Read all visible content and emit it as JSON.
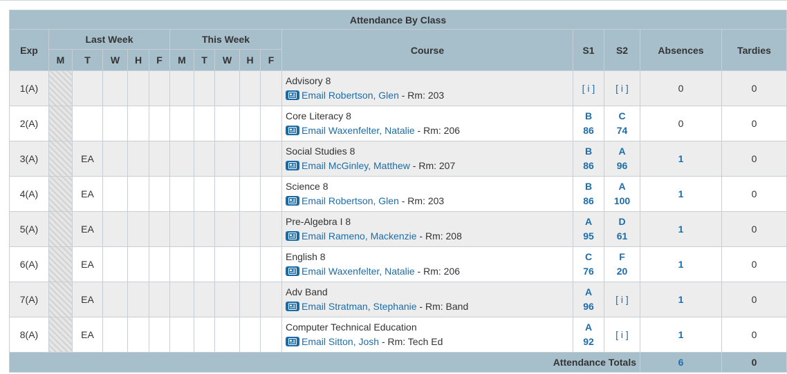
{
  "title": "Attendance By Class",
  "headers": {
    "exp": "Exp",
    "last_week": "Last Week",
    "this_week": "This Week",
    "course": "Course",
    "s1": "S1",
    "s2": "S2",
    "absences": "Absences",
    "tardies": "Tardies",
    "days": [
      "M",
      "T",
      "W",
      "H",
      "F",
      "M",
      "T",
      "W",
      "H",
      "F"
    ]
  },
  "email_label": "Email",
  "rows": [
    {
      "exp": "1(A)",
      "days": [
        "",
        "",
        "",
        "",
        "",
        "",
        "",
        "",
        "",
        ""
      ],
      "course": "Advisory 8",
      "teacher": "Robertson, Glen",
      "room": " - Rm: 203",
      "s1_grade": "[ i ]",
      "s1_pct": "",
      "s2_grade": "[ i ]",
      "s2_pct": "",
      "absences": "0",
      "tardies": "0"
    },
    {
      "exp": "2(A)",
      "days": [
        "",
        "",
        "",
        "",
        "",
        "",
        "",
        "",
        "",
        ""
      ],
      "course": "Core Literacy 8",
      "teacher": "Waxenfelter, Natalie",
      "room": " - Rm: 206",
      "s1_grade": "B",
      "s1_pct": "86",
      "s2_grade": "C",
      "s2_pct": "74",
      "absences": "0",
      "tardies": "0"
    },
    {
      "exp": "3(A)",
      "days": [
        "",
        "EA",
        "",
        "",
        "",
        "",
        "",
        "",
        "",
        ""
      ],
      "course": "Social Studies 8",
      "teacher": "McGinley, Matthew",
      "room": " - Rm: 207",
      "s1_grade": "B",
      "s1_pct": "86",
      "s2_grade": "A",
      "s2_pct": "96",
      "absences": "1",
      "tardies": "0"
    },
    {
      "exp": "4(A)",
      "days": [
        "",
        "EA",
        "",
        "",
        "",
        "",
        "",
        "",
        "",
        ""
      ],
      "course": "Science 8",
      "teacher": "Robertson, Glen",
      "room": " - Rm: 203",
      "s1_grade": "B",
      "s1_pct": "86",
      "s2_grade": "A",
      "s2_pct": "100",
      "absences": "1",
      "tardies": "0"
    },
    {
      "exp": "5(A)",
      "days": [
        "",
        "EA",
        "",
        "",
        "",
        "",
        "",
        "",
        "",
        ""
      ],
      "course": "Pre-Algebra I 8",
      "teacher": "Rameno, Mackenzie",
      "room": " - Rm: 208",
      "s1_grade": "A",
      "s1_pct": "95",
      "s2_grade": "D",
      "s2_pct": "61",
      "absences": "1",
      "tardies": "0"
    },
    {
      "exp": "6(A)",
      "days": [
        "",
        "EA",
        "",
        "",
        "",
        "",
        "",
        "",
        "",
        ""
      ],
      "course": "English 8",
      "teacher": "Waxenfelter, Natalie",
      "room": " - Rm: 206",
      "s1_grade": "C",
      "s1_pct": "76",
      "s2_grade": "F",
      "s2_pct": "20",
      "absences": "1",
      "tardies": "0"
    },
    {
      "exp": "7(A)",
      "days": [
        "",
        "EA",
        "",
        "",
        "",
        "",
        "",
        "",
        "",
        ""
      ],
      "course": "Adv Band",
      "teacher": "Stratman, Stephanie",
      "room": " - Rm: Band",
      "s1_grade": "A",
      "s1_pct": "96",
      "s2_grade": "[ i ]",
      "s2_pct": "",
      "absences": "1",
      "tardies": "0"
    },
    {
      "exp": "8(A)",
      "days": [
        "",
        "EA",
        "",
        "",
        "",
        "",
        "",
        "",
        "",
        ""
      ],
      "course": "Computer Technical Education",
      "teacher": "Sitton, Josh",
      "room": " - Rm: Tech Ed",
      "s1_grade": "A",
      "s1_pct": "92",
      "s2_grade": "[ i ]",
      "s2_pct": "",
      "absences": "1",
      "tardies": "0"
    }
  ],
  "totals": {
    "label": "Attendance Totals",
    "absences": "6",
    "tardies": "0"
  },
  "colors": {
    "header_bg": "#a7bfcb",
    "link": "#1d6da8",
    "odd_row": "#ededed",
    "icon_bg": "#1a6aa6"
  }
}
